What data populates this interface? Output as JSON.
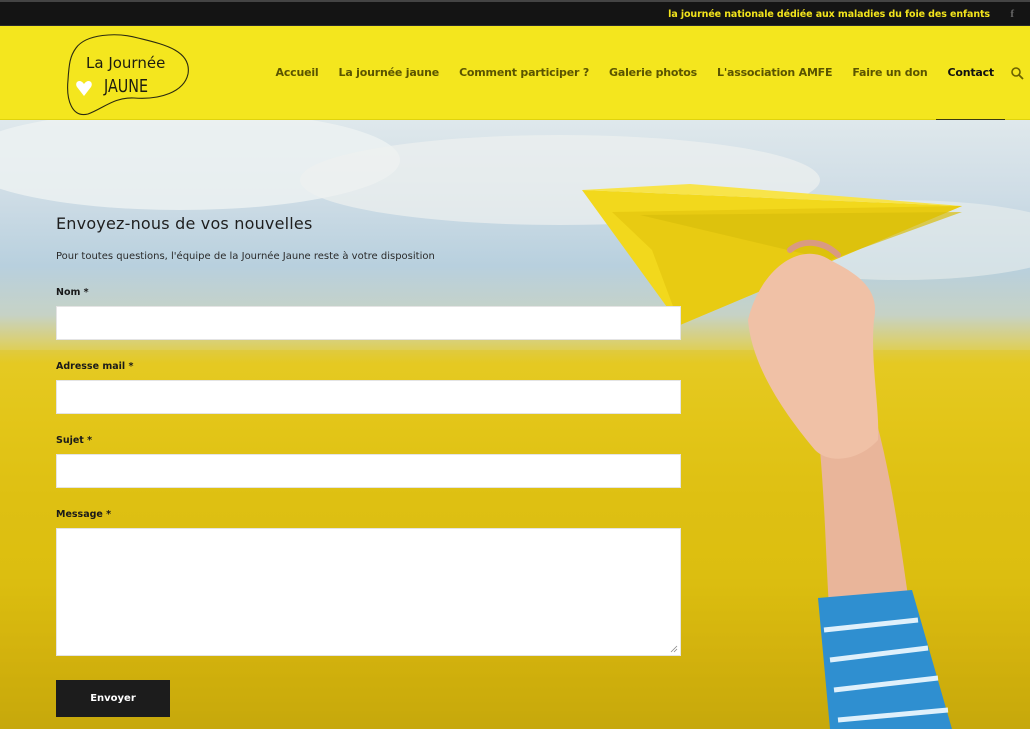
{
  "topbar": {
    "tagline": "la journée nationale dédiée aux maladies du foie des enfants",
    "facebook_glyph": "f"
  },
  "logo": {
    "line1": "La Journée",
    "line2": "JAUNE"
  },
  "nav": {
    "items": [
      {
        "label": "Accueil"
      },
      {
        "label": "La journée jaune"
      },
      {
        "label": "Comment participer ?"
      },
      {
        "label": "Galerie photos"
      },
      {
        "label": "L'association AMFE"
      },
      {
        "label": "Faire un don"
      },
      {
        "label": "Contact"
      }
    ],
    "active_index": 6
  },
  "form": {
    "title": "Envoyez-nous de vos nouvelles",
    "subtitle": "Pour toutes questions, l'équipe de la Journée Jaune reste à votre disposition",
    "fields": [
      {
        "label": "Nom *",
        "value": ""
      },
      {
        "label": "Adresse mail *",
        "value": ""
      },
      {
        "label": "Sujet *",
        "value": ""
      },
      {
        "label": "Message *",
        "value": ""
      }
    ],
    "submit_label": "Envoyer"
  },
  "colors": {
    "brand_yellow": "#f4e61e",
    "topbar_bg": "#141414",
    "tagline": "#f2e31c",
    "button_bg": "#1c1c1c"
  },
  "icons": {
    "search": "search-icon",
    "facebook": "facebook-icon",
    "heart": "heart-icon"
  }
}
